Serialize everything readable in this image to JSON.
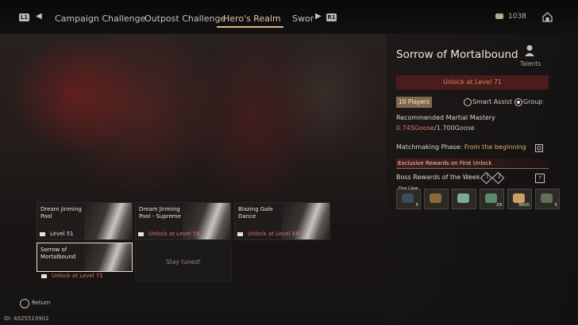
{
  "topbar": {
    "left_key": "L1",
    "right_key": "R1",
    "tabs": [
      "Campaign Challenge",
      "Outpost Challenge",
      "Hero's Realm",
      "Swor"
    ],
    "active_tab": "Hero's Realm",
    "currency_value": "1038"
  },
  "detail": {
    "title": "Sorrow of Mortalbound",
    "talents_label": "Talents",
    "unlock_text": "Unlock at Level 71",
    "players_badge": "10 Players",
    "radio_smart_assist": "Smart Assist",
    "radio_group": "Group",
    "selected_mode": "Group",
    "mastery_label": "Recommended Martial Mastery",
    "mastery_current": "0.745Goose",
    "mastery_sep": "/",
    "mastery_required": "1.700Goose",
    "matchmaking_label": "Matchmaking Phase:",
    "matchmaking_value": "From the beginning",
    "exclusive_rewards": "Exclusive Rewards on First Unlock",
    "boss_rewards_label": "Boss Rewards of the Week",
    "badge_1": "1",
    "badge_2": "2",
    "help": "?"
  },
  "rewards": [
    {
      "tag": "First Clear",
      "count": "5",
      "color": "#3d4a5a"
    },
    {
      "tag": "",
      "count": "",
      "color": "#8a6a3a"
    },
    {
      "tag": "",
      "count": "",
      "color": "#7fa89a"
    },
    {
      "tag": "",
      "count": "29",
      "color": "#5e8a6e"
    },
    {
      "tag": "",
      "count": "9600",
      "color": "#c9a060"
    },
    {
      "tag": "",
      "count": "5",
      "color": "#5f6f5a"
    },
    {
      "tag": "",
      "count": "",
      "color": "#4a7a6a"
    }
  ],
  "cards": [
    {
      "name": "Dream Jinming Pool",
      "status": "Level 51",
      "locked": false
    },
    {
      "name": "Dream Jinming Pool - Supreme",
      "status": "Unlock at Level 56",
      "locked": true
    },
    {
      "name": "Blazing Gale Dance",
      "status": "Unlock at Level 66",
      "locked": true
    },
    {
      "name": "Sorrow of Mortalbound",
      "status": "Unlock at Level 71",
      "locked": true
    }
  ],
  "stay_tuned": "Stay tuned!",
  "footer": {
    "return_label": "Return",
    "uid": "ID: 4025519902"
  },
  "colors": {
    "accent_gold": "#d9b98a",
    "locked_red": "#e17466",
    "unlock_bar": "#4a1c1a"
  }
}
